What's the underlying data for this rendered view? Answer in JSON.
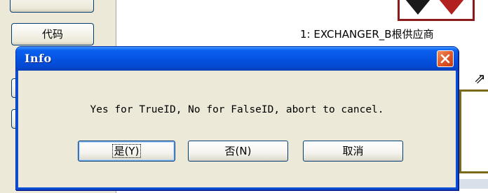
{
  "background_app": {
    "side_button_code_label": "代码",
    "canvas_label": "1: EXCHANGER_B根供应商"
  },
  "dialog": {
    "title": "Info",
    "message": "Yes for TrueID, No for FalseID, abort to cancel.",
    "buttons": {
      "yes_label": "是(Y)",
      "no_label": "否(N)",
      "cancel_label": "取消"
    },
    "close_icon": "close-x-icon"
  },
  "colors": {
    "title_bar": "#0554e3",
    "dialog_face": "#ece9d8",
    "close_button": "#e05a2a",
    "button_border": "#003c74"
  }
}
